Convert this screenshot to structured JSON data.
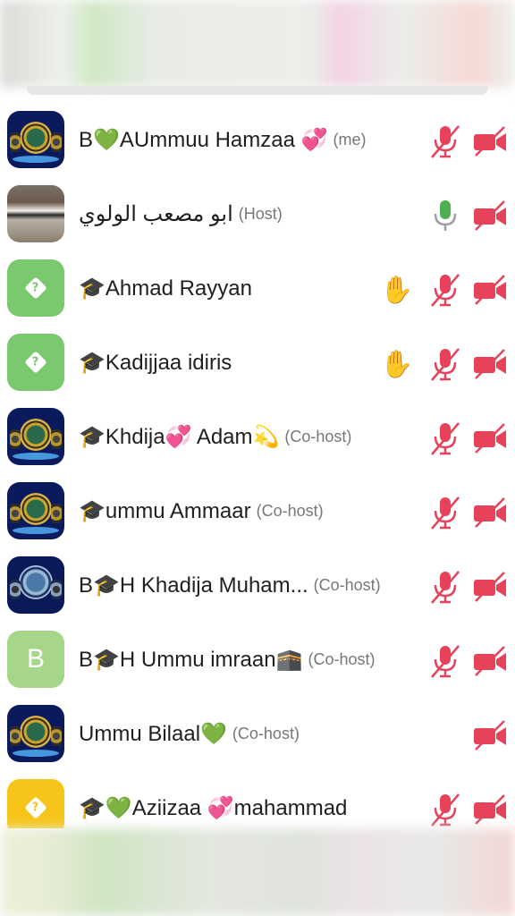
{
  "participants": [
    {
      "name": "B💚AUmmuu Hamzaa 💞",
      "role": "(me)",
      "avatar": "logo",
      "mic": "muted",
      "cam": "off",
      "hand": false
    },
    {
      "name": "ابو مصعب الولوي",
      "role": "(Host)",
      "avatar": "photo",
      "mic": "on",
      "cam": "off",
      "hand": false
    },
    {
      "name": "🎓Ahmad Rayyan",
      "role": "",
      "avatar": "green-diamond",
      "mic": "muted",
      "cam": "off",
      "hand": true
    },
    {
      "name": "🎓Kadijjaa idiris",
      "role": "",
      "avatar": "green-diamond",
      "mic": "muted",
      "cam": "off",
      "hand": true
    },
    {
      "name": "🎓Khdija💞 Adam💫",
      "role": "(Co-host)",
      "avatar": "logo",
      "mic": "muted",
      "cam": "off",
      "hand": false
    },
    {
      "name": "🎓ummu Ammaar",
      "role": "(Co-host)",
      "avatar": "logo",
      "mic": "muted",
      "cam": "off",
      "hand": false
    },
    {
      "name": "B🎓H Khadija Muham...",
      "role": "(Co-host)",
      "avatar": "logo2",
      "mic": "muted",
      "cam": "off",
      "hand": false
    },
    {
      "name": "B🎓H Ummu imraan🕋",
      "role": "(Co-host)",
      "avatar": "letter",
      "letter": "B",
      "mic": "muted",
      "cam": "off",
      "hand": false
    },
    {
      "name": "Ummu Bilaal💚",
      "role": "(Co-host)",
      "avatar": "logo",
      "mic": "none",
      "cam": "off",
      "hand": false
    },
    {
      "name": "🎓💚Aziizaa 💞mahammad",
      "role": "",
      "avatar": "yellow-diamond",
      "mic": "muted",
      "cam": "off",
      "hand": false
    }
  ],
  "colors": {
    "muted": "#e8425a",
    "mic_on": "#4caf50",
    "hand": "#f5b800"
  },
  "icons": {
    "mic_muted": "mic-muted-icon",
    "mic_on": "mic-icon",
    "cam_off": "camera-off-icon",
    "hand": "raised-hand-icon"
  }
}
